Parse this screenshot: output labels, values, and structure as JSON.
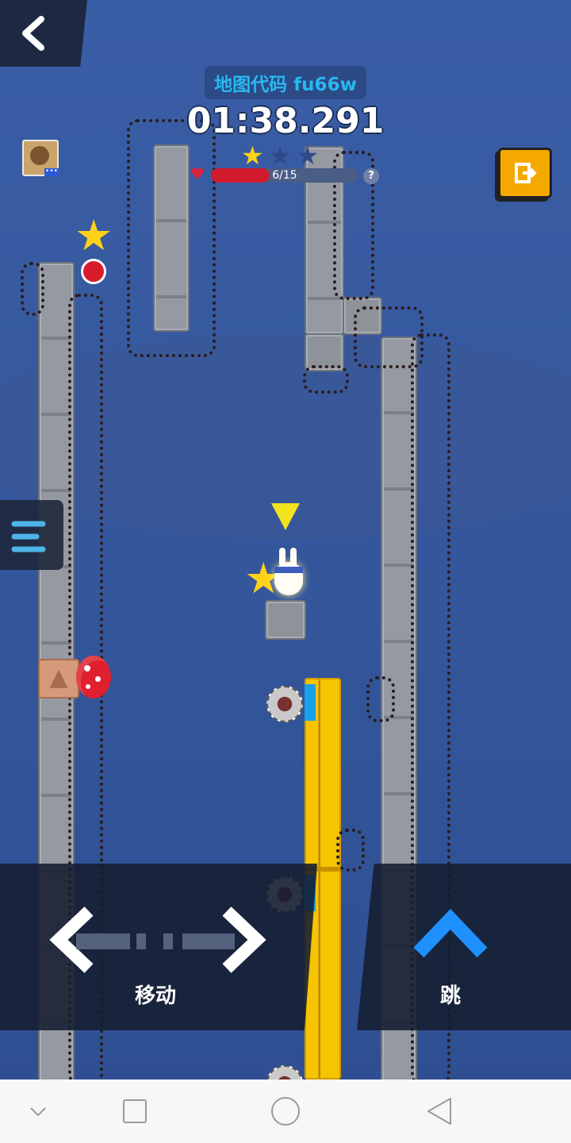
{
  "hud": {
    "map_code": "地图代码 fu66w",
    "timer": "01:38.291",
    "stars_collected": 1,
    "stars_total": 3,
    "health_label": "6/15",
    "health_fraction": 0.4,
    "help_icon_label": "?"
  },
  "controls": {
    "move_label": "移动",
    "jump_label": "跳"
  },
  "colors": {
    "sky": "#34589e",
    "hud_panel": "#1d2942",
    "map_code_text": "#28b8f0",
    "hp_fill": "#d21a2e",
    "jump_arrow": "#1e90ff",
    "gold_block": "#f6c400",
    "share_button": "#f5a800"
  },
  "icons": {
    "back": "chevron-left-icon",
    "share": "share-exit-icon",
    "menu": "hamburger-icon",
    "move_left": "chevron-left-icon",
    "move_right": "chevron-right-icon",
    "jump": "chevron-up-icon"
  }
}
